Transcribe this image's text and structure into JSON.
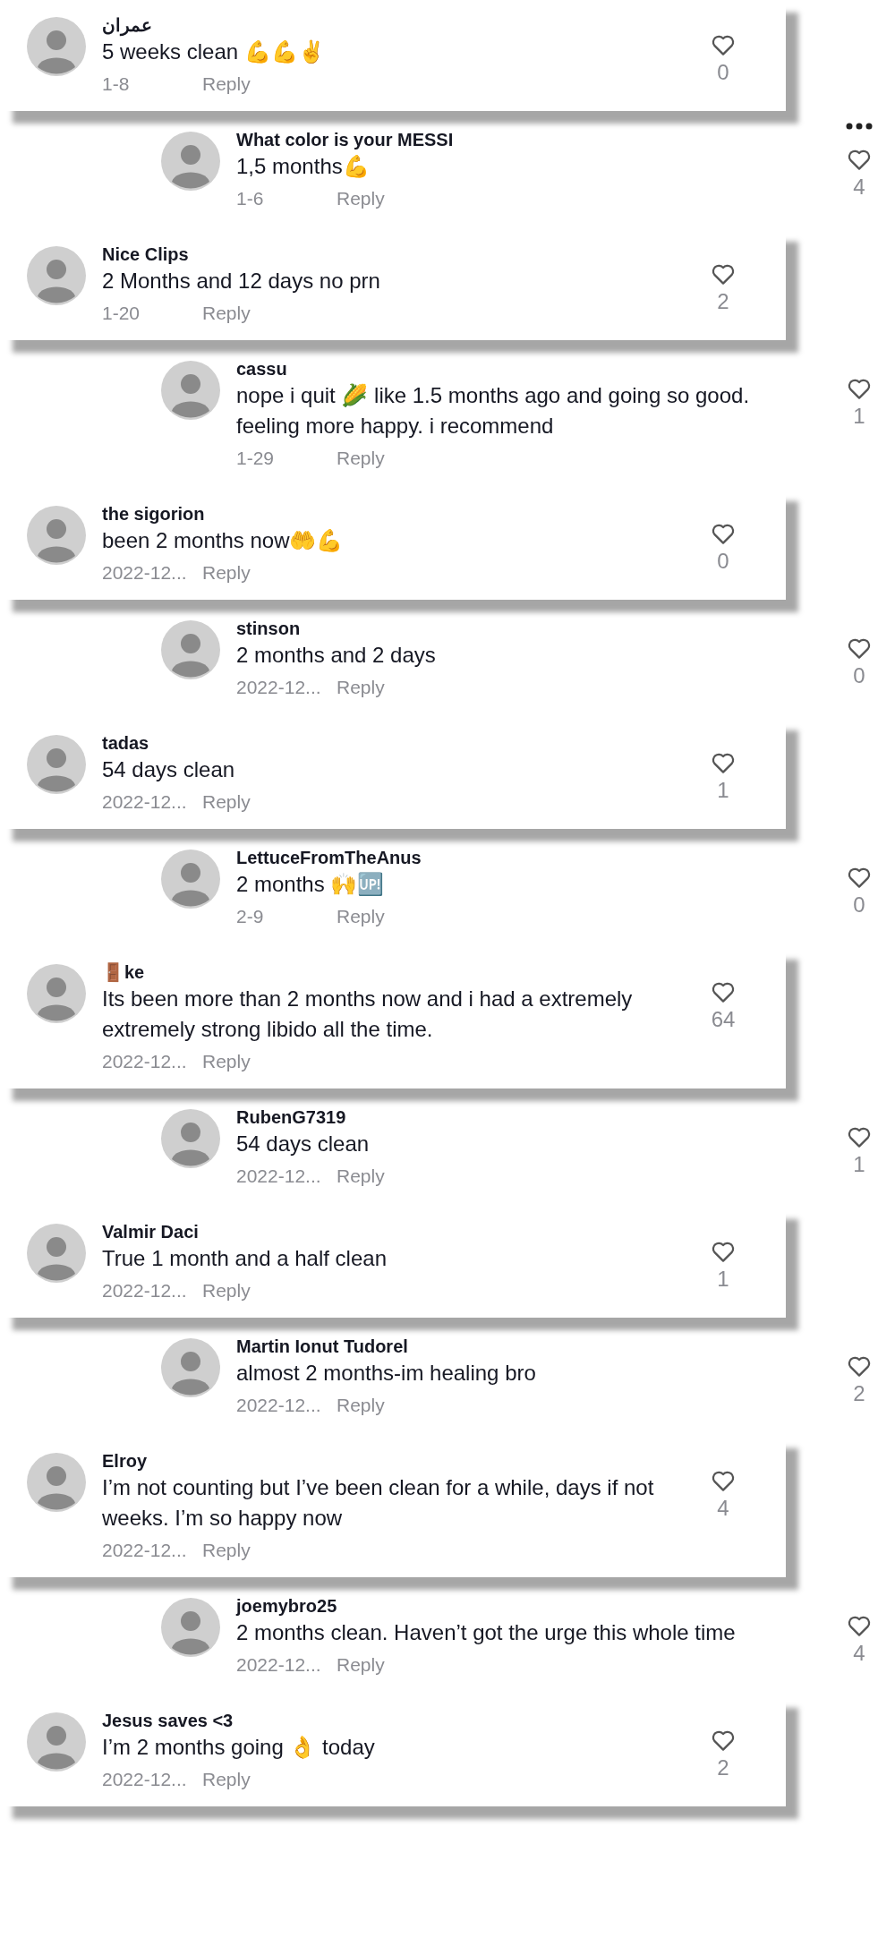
{
  "comments": [
    {
      "kind": "comment",
      "author": "عمران",
      "text": "5 weeks clean 💪💪✌️",
      "date": "1-8",
      "reply": "Reply",
      "likes": "0"
    },
    {
      "kind": "reply",
      "author": "What color is your MESSI",
      "text": "1,5 months💪",
      "date": "1-6",
      "reply": "Reply",
      "likes": "4",
      "more_menu": true
    },
    {
      "kind": "comment",
      "author": "Nice Clips",
      "text": "2 Months and 12 days no prn",
      "date": "1-20",
      "reply": "Reply",
      "likes": "2"
    },
    {
      "kind": "reply",
      "author": "cassu",
      "text": "nope i quit 🌽 like 1.5 months ago and going so good. feeling more happy. i recommend",
      "date": "1-29",
      "reply": "Reply",
      "likes": "1"
    },
    {
      "kind": "comment",
      "author": "the sigorion",
      "text": "been 2 months now🤲💪",
      "date": "2022-12...",
      "reply": "Reply",
      "likes": "0"
    },
    {
      "kind": "reply",
      "author": "stinson",
      "text": "2 months and 2 days",
      "date": "2022-12...",
      "reply": "Reply",
      "likes": "0"
    },
    {
      "kind": "comment",
      "author": "tadas",
      "text": "54 days clean",
      "date": "2022-12...",
      "reply": "Reply",
      "likes": "1"
    },
    {
      "kind": "reply",
      "author": "LettuceFromTheAnus",
      "text": "2 months 🙌🆙",
      "date": "2-9",
      "reply": "Reply",
      "likes": "0"
    },
    {
      "kind": "comment",
      "author": "🚪ke",
      "text": "Its been more than 2 months now and i had a extremely extremely strong libido all the time.",
      "date": "2022-12...",
      "reply": "Reply",
      "likes": "64"
    },
    {
      "kind": "reply",
      "author": "RubenG7319",
      "text": "54 days clean",
      "date": "2022-12...",
      "reply": "Reply",
      "likes": "1"
    },
    {
      "kind": "comment",
      "author": "Valmir Daci",
      "text": "True 1 month and a half clean",
      "date": "2022-12...",
      "reply": "Reply",
      "likes": "1"
    },
    {
      "kind": "reply",
      "author": "Martin Ionut Tudorel",
      "text": "almost 2 months-im healing bro",
      "date": "2022-12...",
      "reply": "Reply",
      "likes": "2"
    },
    {
      "kind": "comment",
      "author": "Elroy",
      "text": "I’m not counting but I’ve been clean for a while, days if not weeks. I’m so happy now",
      "date": "2022-12...",
      "reply": "Reply",
      "likes": "4"
    },
    {
      "kind": "reply",
      "author": "joemybro25",
      "text": "2 months clean. Haven’t got the urge this whole time",
      "date": "2022-12...",
      "reply": "Reply",
      "likes": "4"
    },
    {
      "kind": "comment",
      "author": "Jesus saves <3",
      "text": "I’m 2 months going 👌 today",
      "date": "2022-12...",
      "reply": "Reply",
      "likes": "2"
    }
  ]
}
